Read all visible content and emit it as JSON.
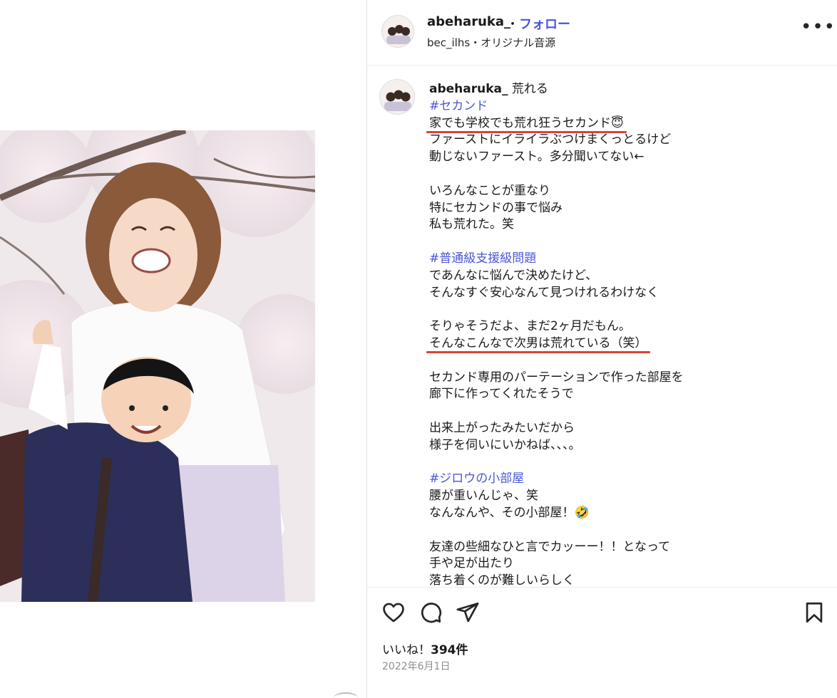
{
  "header": {
    "username": "abeharuka_",
    "separator": "・",
    "follow_label": "フォロー",
    "subline": "bec_ilhs・オリジナル音源",
    "more_icon": "more-horizontal-icon"
  },
  "caption": {
    "username": "abeharuka_",
    "first_text": "荒れる",
    "lines": [
      {
        "text": "#セカンド",
        "type": "tag"
      },
      {
        "text": "家でも学校でも荒れ狂うセカンド😇",
        "type": "text",
        "underline": true
      },
      {
        "text": "ファーストにイライラぶつけまくっとるけど",
        "type": "text"
      },
      {
        "text": "動じないファースト。多分聞いてない←",
        "type": "text"
      },
      {
        "text": "",
        "type": "blank"
      },
      {
        "text": "いろんなことが重なり",
        "type": "text"
      },
      {
        "text": "特にセカンドの事で悩み",
        "type": "text"
      },
      {
        "text": "私も荒れた。笑",
        "type": "text"
      },
      {
        "text": "",
        "type": "blank"
      },
      {
        "text": "#普通級支援級問題",
        "type": "tag"
      },
      {
        "text": "であんなに悩んで決めたけど、",
        "type": "text"
      },
      {
        "text": "そんなすぐ安心なんて見つけれるわけなく",
        "type": "text"
      },
      {
        "text": "",
        "type": "blank"
      },
      {
        "text": "そりゃそうだよ、まだ2ヶ月だもん。",
        "type": "text"
      },
      {
        "text": "そんなこんなで次男は荒れている（笑）",
        "type": "text",
        "underline": true
      },
      {
        "text": "",
        "type": "blank"
      },
      {
        "text": "セカンド専用のパーテーションで作った部屋を",
        "type": "text"
      },
      {
        "text": "廊下に作ってくれたそうで",
        "type": "text"
      },
      {
        "text": "",
        "type": "blank"
      },
      {
        "text": "出来上がったみたいだから",
        "type": "text"
      },
      {
        "text": "様子を伺いにいかねば、、、。",
        "type": "text"
      },
      {
        "text": "",
        "type": "blank"
      },
      {
        "text": "#ジロウの小部屋",
        "type": "tag"
      },
      {
        "text": "腰が重いんじゃ、笑",
        "type": "text"
      },
      {
        "text": "なんなんや、その小部屋！🤣",
        "type": "text"
      },
      {
        "text": "",
        "type": "blank"
      },
      {
        "text": "友達の些細なひと言でカッーー！！となって",
        "type": "text"
      },
      {
        "text": "手や足が出たり",
        "type": "text"
      },
      {
        "text": "落ち着くのが難しいらしく",
        "type": "text"
      }
    ]
  },
  "actions": {
    "like_icon": "heart-icon",
    "comment_icon": "comment-icon",
    "share_icon": "send-icon",
    "save_icon": "bookmark-icon"
  },
  "likes": {
    "prefix": "いいね！",
    "count": "394件"
  },
  "date": "2022年6月1日",
  "colors": {
    "link": "#4a56d6",
    "underline": "#d64535",
    "muted": "#8e8e8e"
  }
}
